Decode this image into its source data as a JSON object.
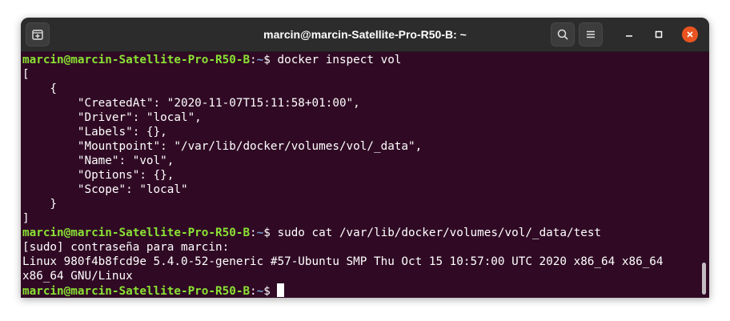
{
  "window": {
    "title": "marcin@marcin-Satellite-Pro-R50-B: ~",
    "buttons": {
      "new_tab_icon": "new-tab-icon",
      "search_icon": "search-icon",
      "menu_icon": "hamburger-menu-icon",
      "minimize_icon": "minimize-icon",
      "maximize_icon": "maximize-icon",
      "close_icon": "close-icon"
    }
  },
  "colors": {
    "terminal_bg": "#300a24",
    "prompt_user": "#8ae234",
    "prompt_path": "#729fcf",
    "close_button": "#e95420"
  },
  "terminal": {
    "prompt": {
      "user_host": "marcin@marcin-Satellite-Pro-R50-B",
      "sep": ":",
      "path": "~",
      "symbol": "$ "
    },
    "cmd1": "docker inspect vol",
    "json_lines": [
      "[",
      "    {",
      "        \"CreatedAt\": \"2020-11-07T15:11:58+01:00\",",
      "        \"Driver\": \"local\",",
      "        \"Labels\": {},",
      "        \"Mountpoint\": \"/var/lib/docker/volumes/vol/_data\",",
      "        \"Name\": \"vol\",",
      "        \"Options\": {},",
      "        \"Scope\": \"local\"",
      "    }",
      "]"
    ],
    "cmd2": "sudo cat /var/lib/docker/volumes/vol/_data/test",
    "output_lines": [
      "[sudo] contraseña para marcin:",
      "Linux 980f4b8fcd9e 5.4.0-52-generic #57-Ubuntu SMP Thu Oct 15 10:57:00 UTC 2020 x86_64 x86_64",
      "x86_64 GNU/Linux"
    ]
  }
}
